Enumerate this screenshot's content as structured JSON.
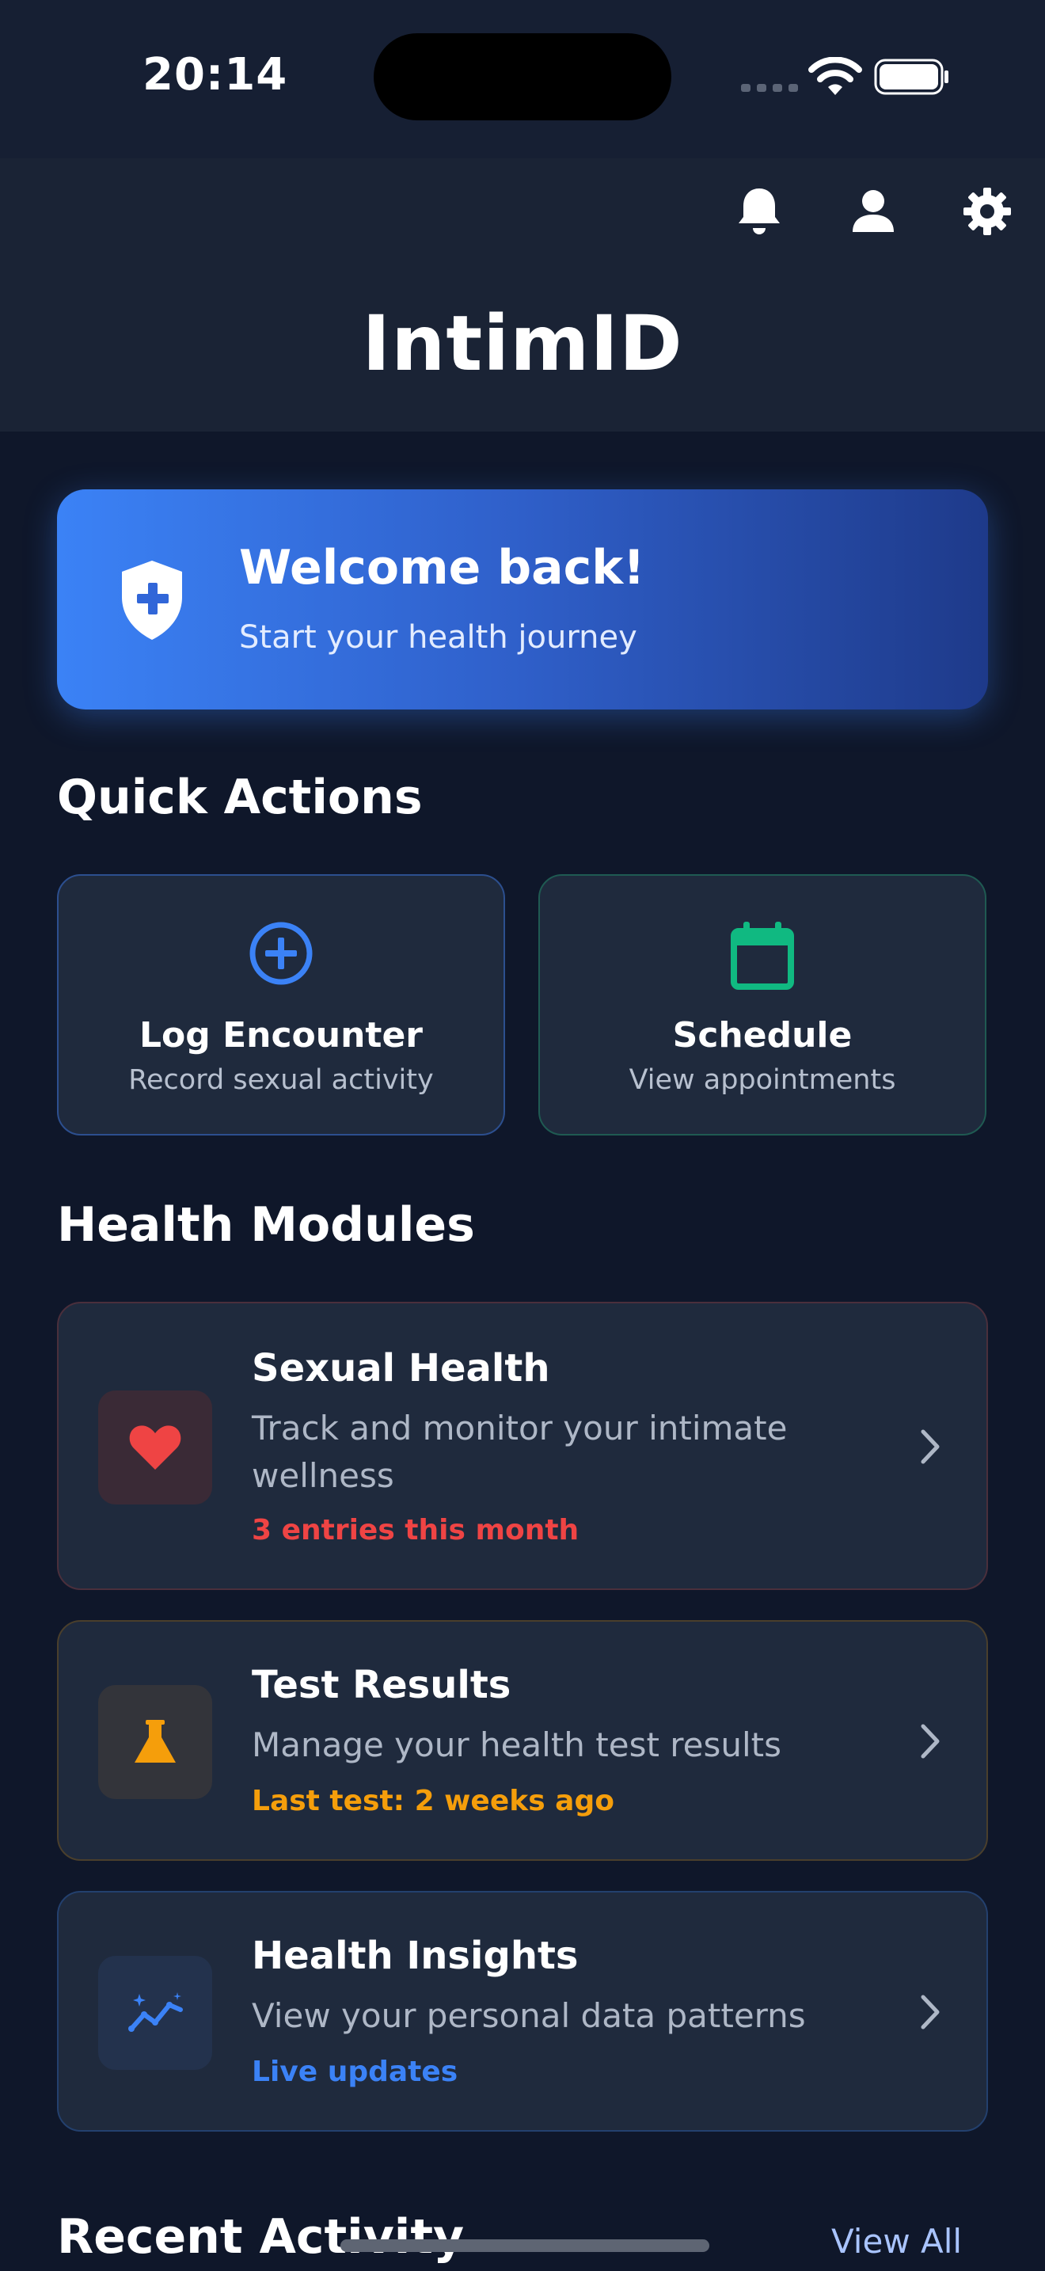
{
  "status_bar": {
    "time": "20:14"
  },
  "header": {
    "app_title": "IntimID",
    "icons": [
      "bell-icon",
      "user-icon",
      "gear-icon"
    ]
  },
  "welcome": {
    "title": "Welcome back!",
    "subtitle": "Start your health journey",
    "icon": "shield-plus-icon"
  },
  "quick_actions": {
    "title": "Quick Actions",
    "items": [
      {
        "label": "Log Encounter",
        "subtitle": "Record sexual activity",
        "icon": "plus-circle-icon",
        "color": "#3b82f6"
      },
      {
        "label": "Schedule",
        "subtitle": "View appointments",
        "icon": "calendar-icon",
        "color": "#10b981"
      }
    ]
  },
  "health_modules": {
    "title": "Health Modules",
    "items": [
      {
        "title": "Sexual Health",
        "description": "Track and monitor your intimate wellness",
        "meta": "3 entries this month",
        "meta_color": "#ef4444",
        "icon": "heart-icon"
      },
      {
        "title": "Test Results",
        "description": "Manage your health test results",
        "meta": "Last test: 2 weeks ago",
        "meta_color": "#f59e0b",
        "icon": "flask-icon"
      },
      {
        "title": "Health Insights",
        "description": "View your personal data patterns",
        "meta": "Live updates",
        "meta_color": "#3b82f6",
        "icon": "trend-icon"
      }
    ]
  },
  "recent_activity": {
    "title": "Recent Activity",
    "view_all": "View All"
  },
  "colors": {
    "background": "#0f172a",
    "card": "#1f2a3d",
    "accent_blue": "#3b82f6",
    "accent_green": "#10b981",
    "accent_red": "#ef4444",
    "accent_amber": "#f59e0b"
  }
}
